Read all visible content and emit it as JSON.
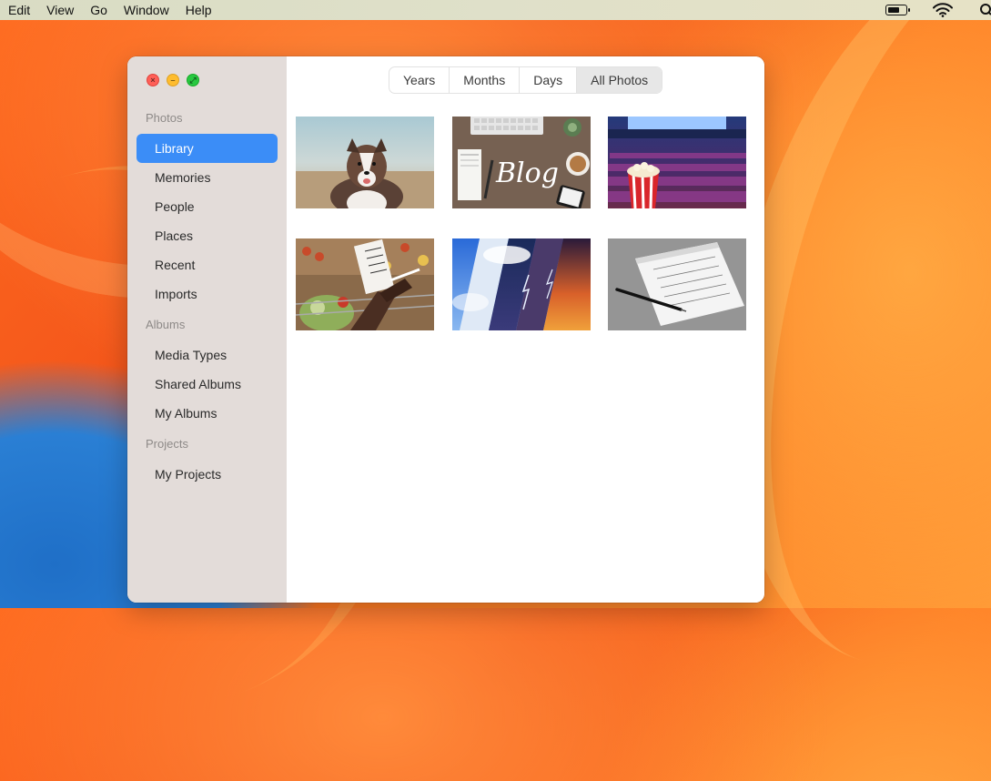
{
  "menubar": {
    "items": [
      "Edit",
      "View",
      "Go",
      "Window",
      "Help"
    ]
  },
  "window": {
    "sidebar": {
      "sections": [
        {
          "title": "Photos",
          "items": [
            "Library",
            "Memories",
            "People",
            "Places",
            "Recent",
            "Imports"
          ]
        },
        {
          "title": "Albums",
          "items": [
            "Media Types",
            "Shared Albums",
            "My Albums"
          ]
        },
        {
          "title": "Projects",
          "items": [
            "My Projects"
          ]
        }
      ],
      "selected": "Library"
    },
    "view_tabs": [
      "Years",
      "Months",
      "Days",
      "All Photos"
    ],
    "selected_tab": "All Photos",
    "photos": [
      {
        "subject": "dog"
      },
      {
        "subject": "blog-desk"
      },
      {
        "subject": "cinema-popcorn"
      },
      {
        "subject": "grocery-list"
      },
      {
        "subject": "weather-collage"
      },
      {
        "subject": "notepad-pen"
      }
    ]
  },
  "colors": {
    "accent": "#3b8df7",
    "sidebar_bg": "#e3dcd9"
  },
  "icons": [
    "close-icon",
    "minimize-icon",
    "zoom-icon",
    "battery-icon",
    "wifi-icon",
    "search-icon"
  ]
}
